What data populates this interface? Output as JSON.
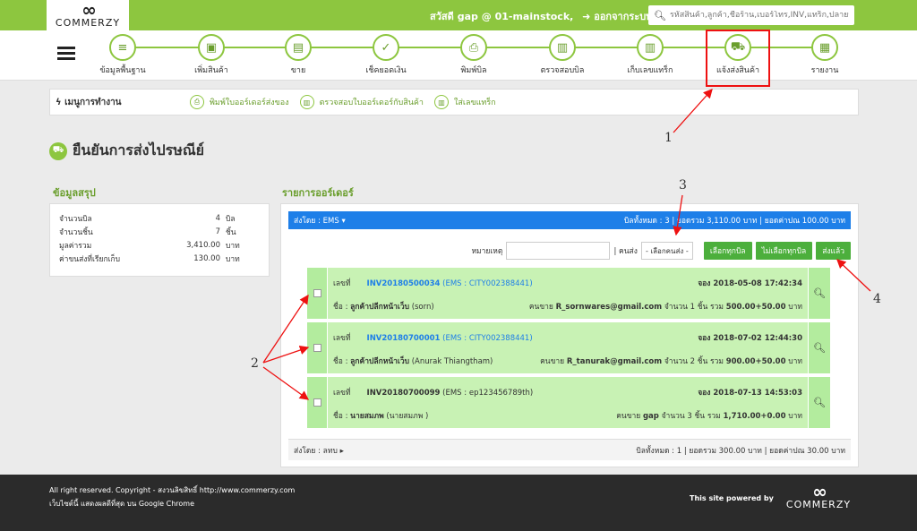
{
  "brand": {
    "mark": "CO",
    "name": "COMMERZY"
  },
  "topbar": {
    "greeting": "สวัสดี",
    "user": "gap @ 01-mainstock",
    "logout": "ออกจากระบบ",
    "search_placeholder": "รหัสสินค้า,ลูกค้า,ชื่อร้าน,เบอร์โทร,INV,แทร็ก,ปลายทาง"
  },
  "nav": [
    {
      "label": "ข้อมูลพื้นฐาน",
      "icon": "database-icon"
    },
    {
      "label": "เพิ่มสินค้า",
      "icon": "box-icon"
    },
    {
      "label": "ขาย",
      "icon": "cash-register-icon"
    },
    {
      "label": "เช็คยอดเงิน",
      "icon": "check-money-icon"
    },
    {
      "label": "พิมพ์บิล",
      "icon": "printer-icon"
    },
    {
      "label": "ตรวจสอบบิล",
      "icon": "barcode-scan-icon"
    },
    {
      "label": "เก็บเลขแทร็ก",
      "icon": "barcode-scan-icon"
    },
    {
      "label": "แจ้งส่งสินค้า",
      "icon": "truck-icon"
    },
    {
      "label": "รายงาน",
      "icon": "report-icon"
    }
  ],
  "workmenu": {
    "title": "เมนูการทำงาน",
    "items": [
      {
        "label": "พิมพ์ใบออร์เดอร์ส่งของ",
        "icon": "printer-icon"
      },
      {
        "label": "ตรวจสอบใบออร์เดอร์กับสินค้า",
        "icon": "barcode-scan-icon"
      },
      {
        "label": "ใส่เลขแทร็ก",
        "icon": "barcode-scan-icon"
      }
    ]
  },
  "page_title": "ยืนยันการส่งไปรษณีย์",
  "summary": {
    "heading": "ข้อมูลสรุป",
    "rows": [
      {
        "k": "จำนวนบิล",
        "v": "4",
        "u": "บิล"
      },
      {
        "k": "จำนวนชิ้น",
        "v": "7",
        "u": "ชิ้น"
      },
      {
        "k": "มูลค่ารวม",
        "v": "3,410.00",
        "u": "บาท"
      },
      {
        "k": "ค่าขนส่งที่เรียกเก็บ",
        "v": "130.00",
        "u": "บาท"
      }
    ]
  },
  "orders": {
    "heading": "รายการออร์เดอร์",
    "group_label": "ส่งโดย : EMS",
    "group_summary": "บิลทั้งหมด : 3 | ยอดรวม 3,110.00 บาท | ยอดค่าปณ 100.00 บาท",
    "note_label": "หมายเหตุ",
    "sender_label": "| คนส่ง",
    "sender_select": "- เลือกคนส่ง -",
    "btn_select_all": "เลือกทุกบิล",
    "btn_deselect_all": "ไม่เลือกทุกบิล",
    "btn_sent": "ส่งแล้ว",
    "rows": [
      {
        "no_label": "เลขที่",
        "inv": "INV20180500034",
        "ems": "(EMS : CITY002388441)",
        "booked": "จอง 2018-05-08 17:42:34",
        "name_label": "ชื่อ :",
        "name": "ลูกค้าปลีกหน้าเว็บ",
        "name_extra": "(sorn)",
        "seller_label": "คนขาย",
        "seller": "R_sornwares@gmail.com",
        "qty": "จำนวน 1 ชิ้น รวม",
        "total": "500.00+50.00",
        "unit": "บาท"
      },
      {
        "no_label": "เลขที่",
        "inv": "INV20180700001",
        "ems": "(EMS : CITY002388441)",
        "booked": "จอง 2018-07-02 12:44:30",
        "name_label": "ชื่อ :",
        "name": "ลูกค้าปลีกหน้าเว็บ",
        "name_extra": "(Anurak Thiangtham)",
        "seller_label": "คนขาย",
        "seller": "R_tanurak@gmail.com",
        "qty": "จำนวน 2 ชิ้น รวม",
        "total": "900.00+50.00",
        "unit": "บาท"
      },
      {
        "no_label": "เลขที่",
        "inv": "INV20180700099",
        "ems": "(EMS : ep123456789th)",
        "booked": "จอง 2018-07-13 14:53:03",
        "name_label": "ชื่อ :",
        "name": "นายสมภพ",
        "name_extra": "(นายสมภพ )",
        "seller_label": "คนขาย",
        "seller": "gap",
        "qty": "จำนวน 3 ชิ้น รวม",
        "total": "1,710.00+0.00",
        "unit": "บาท"
      }
    ],
    "footer_label": "ส่งโดย : ลทบ",
    "footer_summary": "บิลทั้งหมด : 1 | ยอดรวม 300.00 บาท | ยอดค่าปณ 30.00 บาท"
  },
  "footer": {
    "copyright": "All right reserved. Copyright - สงวนลิขสิทธิ์ http://www.commerzy.com",
    "browser_note": "เว็บไซต์นี้ แสดงผลดีที่สุด บน Google Chrome",
    "powered": "This site powered by"
  },
  "annotations": [
    "1",
    "2",
    "3",
    "4"
  ],
  "colors": {
    "brand_green": "#8dc63f",
    "header_blue": "#1e7fe8",
    "row_green": "#b3ec9e",
    "button_green": "#4caf3c",
    "highlight_red": "#e11111"
  }
}
